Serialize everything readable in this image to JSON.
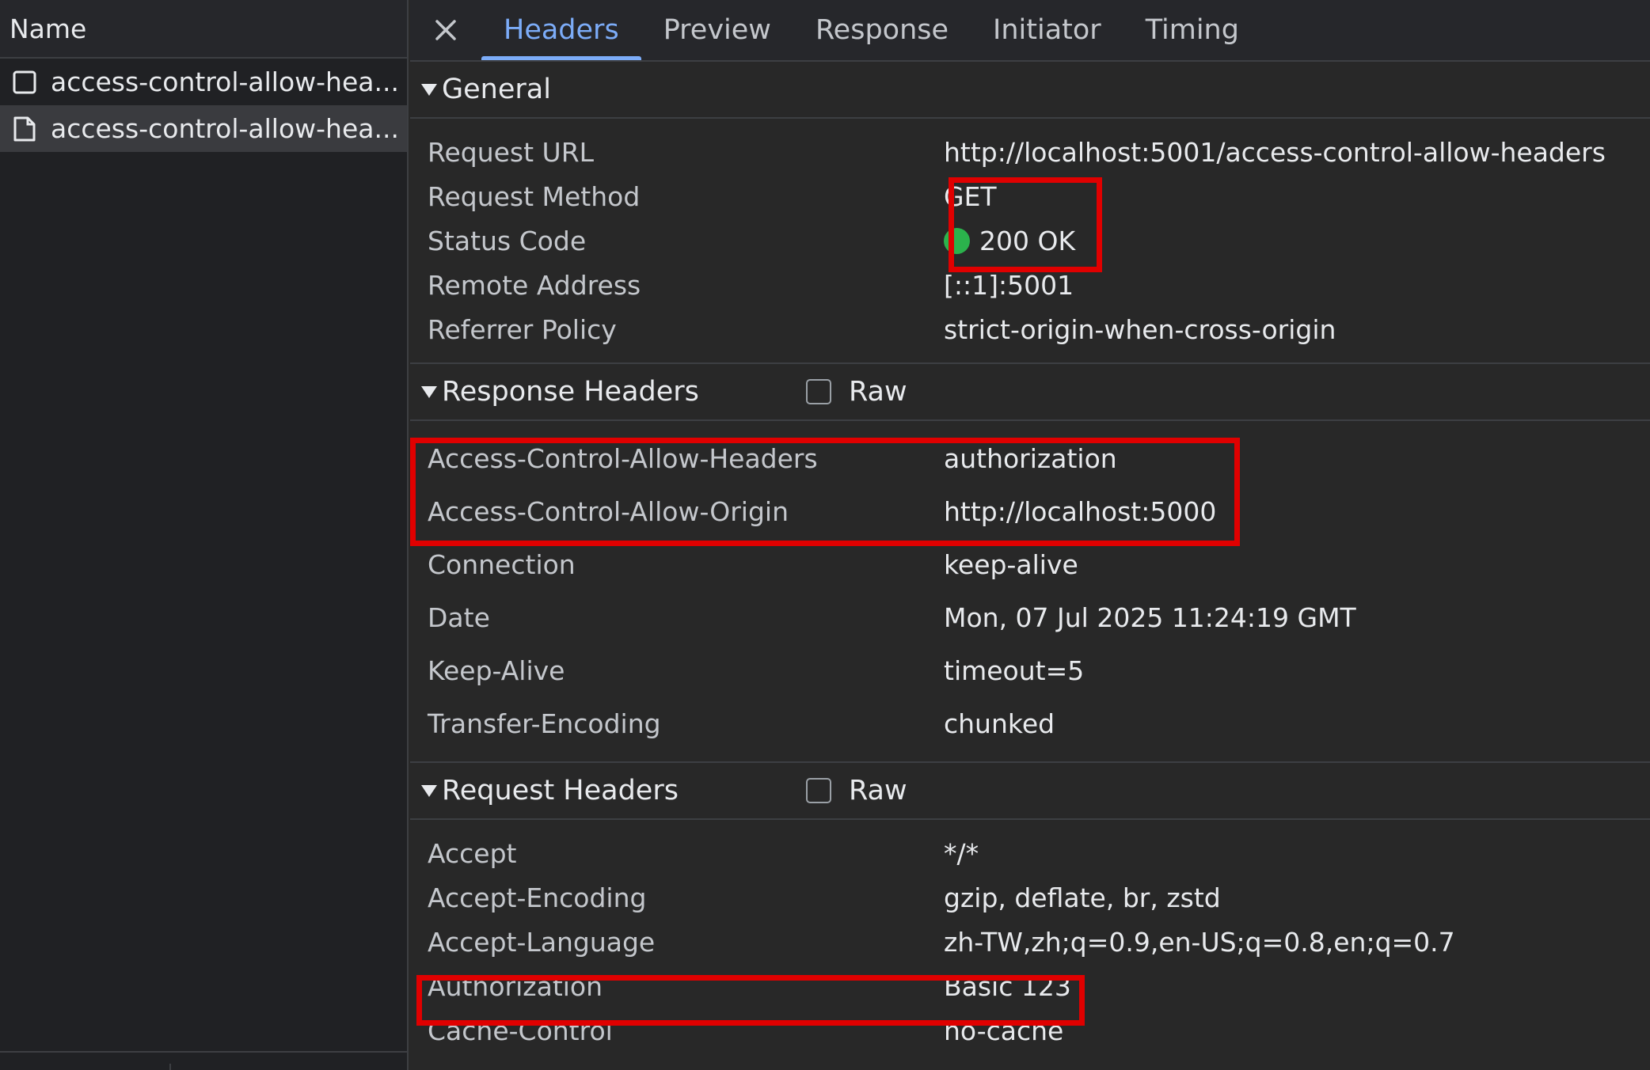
{
  "left_panel": {
    "header": "Name",
    "items": [
      {
        "label": "access-control-allow-hea..."
      },
      {
        "label": "access-control-allow-hea..."
      }
    ]
  },
  "tabs": [
    {
      "label": "Headers",
      "active": true
    },
    {
      "label": "Preview"
    },
    {
      "label": "Response"
    },
    {
      "label": "Initiator"
    },
    {
      "label": "Timing"
    }
  ],
  "general": {
    "title": "General",
    "rows": [
      {
        "key": "Request URL",
        "value": "http://localhost:5001/access-control-allow-headers"
      },
      {
        "key": "Request Method",
        "value": "GET"
      },
      {
        "key": "Status Code",
        "value": "200 OK"
      },
      {
        "key": "Remote Address",
        "value": "[::1]:5001"
      },
      {
        "key": "Referrer Policy",
        "value": "strict-origin-when-cross-origin"
      }
    ]
  },
  "response_headers": {
    "title": "Response Headers",
    "raw_label": "Raw",
    "rows": [
      {
        "key": "Access-Control-Allow-Headers",
        "value": "authorization"
      },
      {
        "key": "Access-Control-Allow-Origin",
        "value": "http://localhost:5000"
      },
      {
        "key": "Connection",
        "value": "keep-alive"
      },
      {
        "key": "Date",
        "value": "Mon, 07 Jul 2025 11:24:19 GMT"
      },
      {
        "key": "Keep-Alive",
        "value": "timeout=5"
      },
      {
        "key": "Transfer-Encoding",
        "value": "chunked"
      }
    ]
  },
  "request_headers": {
    "title": "Request Headers",
    "raw_label": "Raw",
    "rows": [
      {
        "key": "Accept",
        "value": "*/*"
      },
      {
        "key": "Accept-Encoding",
        "value": "gzip, deflate, br, zstd"
      },
      {
        "key": "Accept-Language",
        "value": "zh-TW,zh;q=0.9,en-US;q=0.8,en;q=0.7"
      },
      {
        "key": "Authorization",
        "value": "Basic 123"
      },
      {
        "key": "Cache-Control",
        "value": "no-cache"
      }
    ]
  },
  "colors": {
    "highlight": "#e00000",
    "active_tab": "#7cacf8",
    "status_ok": "#2bb24c"
  }
}
